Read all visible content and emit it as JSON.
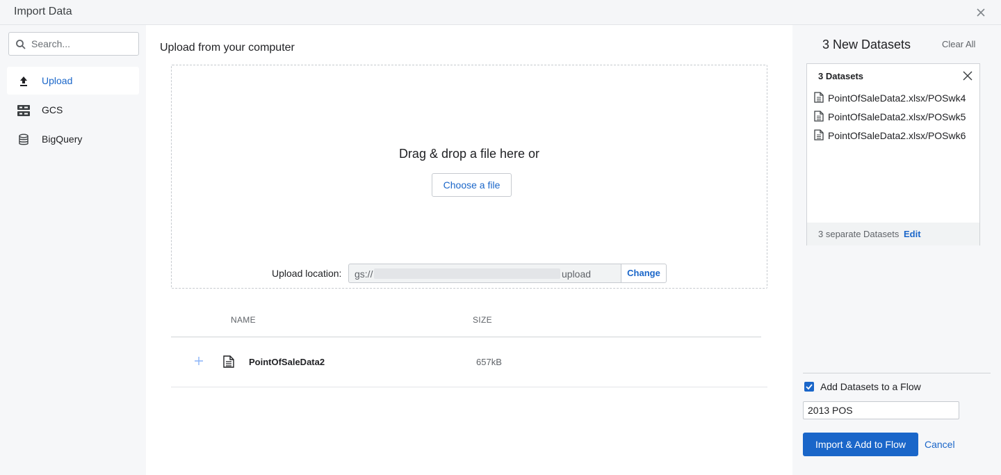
{
  "window": {
    "title": "Import Data"
  },
  "sidebar": {
    "search_placeholder": "Search...",
    "items": [
      {
        "label": "Upload",
        "icon": "upload-icon",
        "active": true
      },
      {
        "label": "GCS",
        "icon": "storage-icon",
        "active": false
      },
      {
        "label": "BigQuery",
        "icon": "database-icon",
        "active": false
      }
    ]
  },
  "main": {
    "heading": "Upload from your computer",
    "dropzone_text": "Drag & drop a file here or",
    "choose_file_label": "Choose a file",
    "upload_location_label": "Upload location:",
    "upload_location_prefix": "gs://",
    "upload_location_suffix": "upload",
    "change_label": "Change",
    "table": {
      "columns": [
        "NAME",
        "SIZE"
      ],
      "rows": [
        {
          "name": "PointOfSaleData2",
          "size": "657kB"
        }
      ]
    }
  },
  "datasets_panel": {
    "title": "3 New Datasets",
    "clear_all": "Clear All",
    "card_title": "3 Datasets",
    "items": [
      "PointOfSaleData2.xlsx/POSwk4",
      "PointOfSaleData2.xlsx/POSwk5",
      "PointOfSaleData2.xlsx/POSwk6"
    ],
    "footer_text": "3 separate Datasets",
    "edit_label": "Edit",
    "add_to_flow_label": "Add Datasets to a Flow",
    "add_to_flow_checked": true,
    "flow_name": "2013 POS",
    "import_button": "Import & Add to Flow",
    "cancel": "Cancel"
  },
  "colors": {
    "accent": "#1a66c9",
    "panel_bg": "#f6f7f9",
    "titlebar_bg": "#f5f6f8"
  }
}
